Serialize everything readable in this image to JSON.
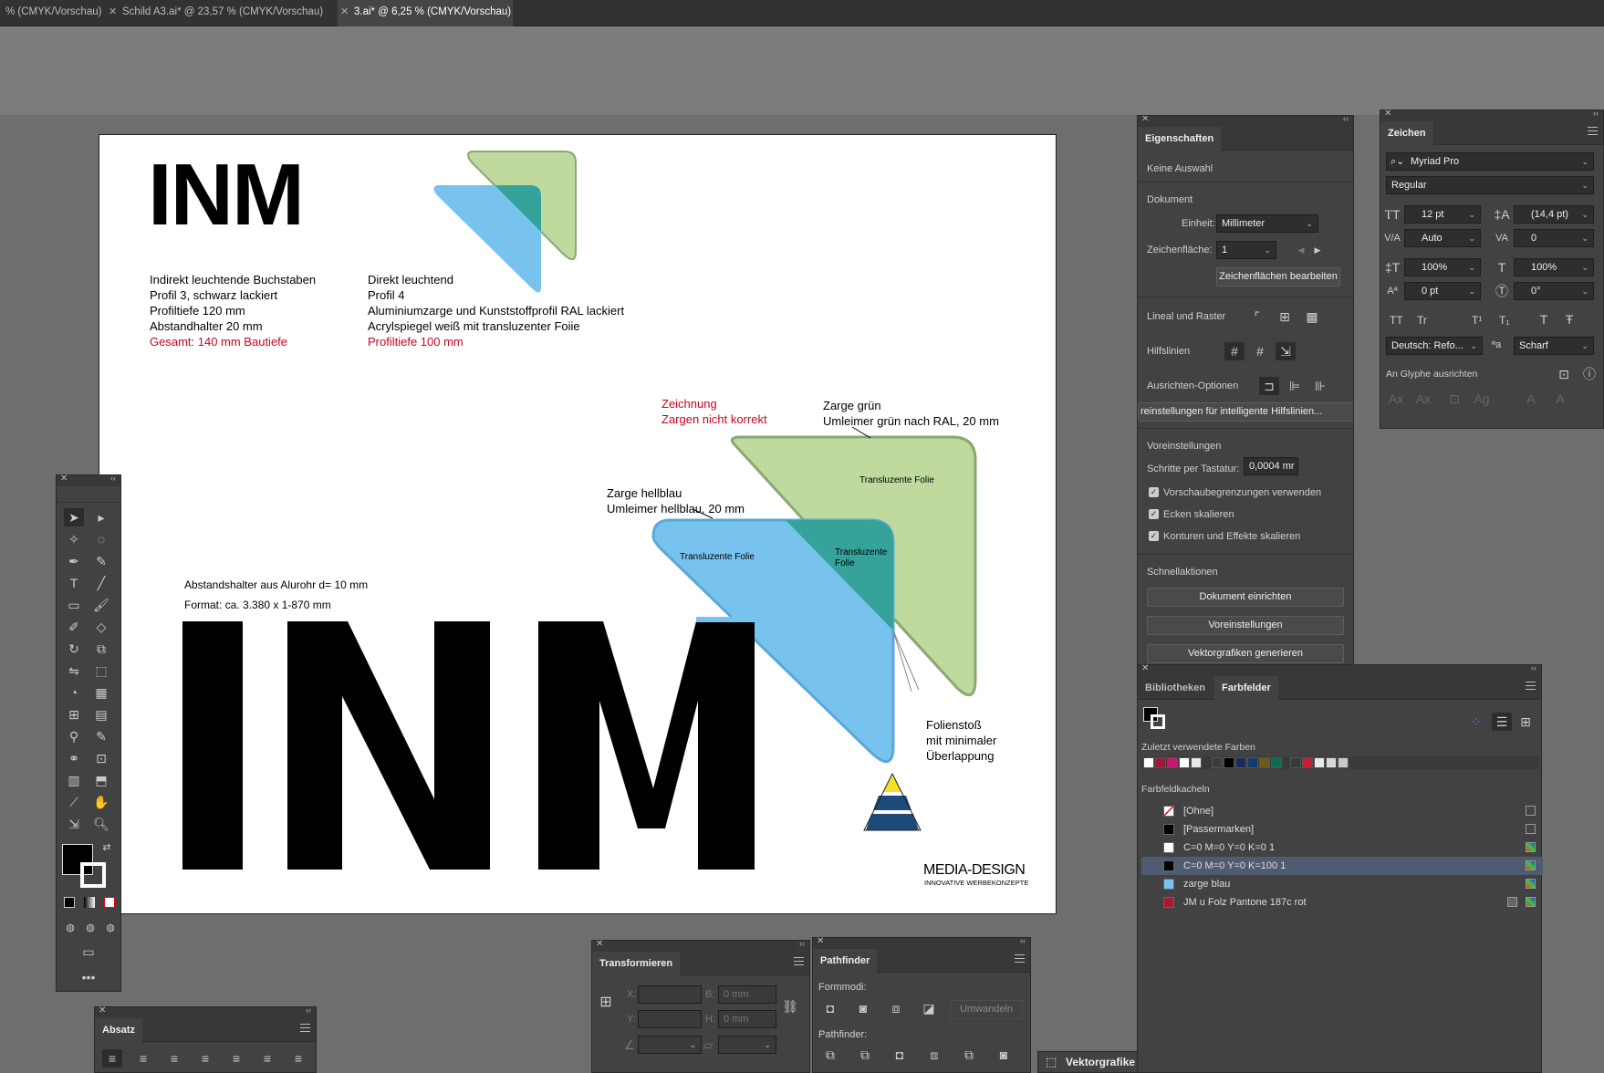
{
  "tabs": [
    {
      "label": "% (CMYK/Vorschau)",
      "active": false
    },
    {
      "label": "Schild A3.ai* @ 23,57 % (CMYK/Vorschau)",
      "active": false
    },
    {
      "label": "3.ai* @ 6,25 % (CMYK/Vorschau)",
      "active": true
    }
  ],
  "artwork": {
    "title_small": "INM",
    "title_big": "INM",
    "left_info": [
      "Indirekt leuchtende Buchstaben",
      "Profil  3, schwarz lackiert",
      "Profiltiefe 120 mm",
      "Abstandhalter  20 mm"
    ],
    "left_info_red": "Gesamt: 140 mm Bautiefe",
    "mid_info": [
      "Direkt leuchtend",
      "Profil  4",
      "Aluminiumzarge und Kunststoffprofil RAL lackiert",
      "Acrylspiegel weiß mit transluzenter Foiie"
    ],
    "mid_info_red": "Profiltiefe 100 mm",
    "note_red": [
      "Zeichnung",
      "Zargen nicht korrekt"
    ],
    "label_green": [
      "Zarge grün",
      "Umleimer grün nach RAL, 20 mm"
    ],
    "label_blue": [
      "Zarge hellblau",
      "Umleimer hellblau, 20 mm"
    ],
    "foil_green": "Transluzente Folie",
    "foil_blue": "Transluzente Folie",
    "foil_teal": [
      "Transluzente",
      "Folie"
    ],
    "spacer": [
      "Abstandshalter aus Alurohr d= 10 mm",
      "Format: ca. 3.380 x 1-870 mm"
    ],
    "folienstoss": [
      "Folienstoß",
      "mit minimaler",
      "Überlappung"
    ],
    "logo_name": "MEDIA-DESIGN",
    "logo_tag": "INNOVATIVE WERBEKONZEPTE",
    "colors": {
      "green": "#bfd99e",
      "green_edge": "#8aa873",
      "blue": "#78c2ee",
      "blue_edge": "#5aa8d8",
      "teal": "#35a39a",
      "red": "#d0021b",
      "logo_yellow": "#f2e02a",
      "logo_blue": "#1e4a7a"
    }
  },
  "eigenschaften": {
    "tab": "Eigenschaften",
    "no_selection": "Keine Auswahl",
    "section_doc": "Dokument",
    "unit_label": "Einheit:",
    "unit_value": "Millimeter",
    "artboard_label": "Zeichenfläche:",
    "artboard_value": "1",
    "edit_artboards": "Zeichenflächen bearbeiten",
    "ruler_grid": "Lineal und Raster",
    "guides": "Hilfslinien",
    "align_options": "Ausrichten-Optionen",
    "smart_guides_btn": "reinstellungen für intelligente Hilfslinien...",
    "prefs": "Voreinstellungen",
    "key_inc_label": "Schritte per Tastatur:",
    "key_inc_value": "0,0004 mr",
    "chk1": "Vorschaubegrenzungen verwenden",
    "chk2": "Ecken skalieren",
    "chk3": "Konturen und Effekte skalieren",
    "quick_actions": "Schnellaktionen",
    "btn_doc_setup": "Dokument einrichten",
    "btn_prefs": "Voreinstellungen",
    "btn_vector": "Vektorgrafiken generieren"
  },
  "zeichen": {
    "tab": "Zeichen",
    "font": "Myriad Pro",
    "style": "Regular",
    "size": "12 pt",
    "leading": "(14,4 pt)",
    "kerning": "Auto",
    "tracking": "0",
    "vscale": "100%",
    "hscale": "100%",
    "baseline": "0 pt",
    "rotation": "0°",
    "tt1": "TT",
    "tt2": "Tr",
    "tt3": "T¹",
    "tt4": "T₁",
    "language": "Deutsch: Refo...",
    "aa_label": "ªa",
    "antialias": "Scharf",
    "glyph_align": "An Glyphe ausrichten"
  },
  "farbfelder": {
    "tab1": "Bibliotheken",
    "tab2": "Farbfelder",
    "recent": "Zuletzt verwendete Farben",
    "groups": "Farbfeldkacheln",
    "recent_colors": [
      "#ffffff",
      "#9b1a3a",
      "#c8176f",
      "#ffffff",
      "#e8e8e8",
      "#3d3d3d",
      "#000000",
      "#1c2b5e",
      "#123b6e",
      "#6b5a1a",
      "#0f6b4e",
      "#3a3a3a",
      "#c8202e",
      "#e8e8e8",
      "#d8d8d8",
      "#c8c8c8"
    ],
    "items": [
      {
        "name": "[Ohne]",
        "color": "none"
      },
      {
        "name": "[Passermarken]",
        "color": "#000000"
      },
      {
        "name": "C=0 M=0 Y=0 K=0 1",
        "color": "#ffffff"
      },
      {
        "name": "C=0 M=0 Y=0 K=100 1",
        "color": "#000000"
      },
      {
        "name": "zarge blau",
        "color": "#78c2ee"
      },
      {
        "name": "JM u Folz Pantone 187c rot",
        "color": "#a6192e"
      }
    ]
  },
  "transform": {
    "tab": "Transformieren",
    "x_label": "X:",
    "y_label": "Y:",
    "w_label": "B:",
    "h_label": "H:",
    "x": "",
    "y": "",
    "w": "0 mm",
    "h": "0 mm"
  },
  "pathfinder": {
    "tab": "Pathfinder",
    "modes": "Formmodi:",
    "expand": "Umwandeln",
    "pathfinders": "Pathfinder:"
  },
  "absatz": {
    "tab": "Absatz"
  },
  "vector_tab": "Vektorgrafike"
}
